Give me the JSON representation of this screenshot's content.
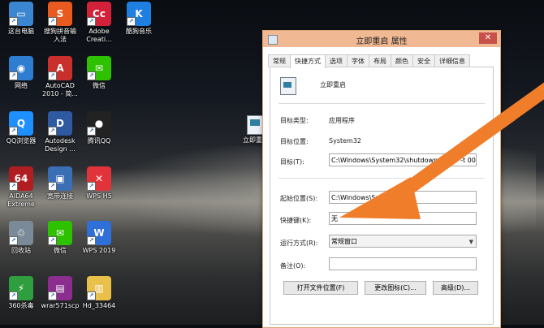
{
  "desktop": {
    "icons": [
      {
        "label": "这台电脑",
        "name": "this-pc-icon",
        "color": "#3a86d1",
        "glyph": "▭"
      },
      {
        "label": "搜狗拼音输\n入法",
        "name": "sogou-input-icon",
        "color": "#e85a1f",
        "glyph": "S"
      },
      {
        "label": "Adobe\nCreati...",
        "name": "adobe-creative-icon",
        "color": "#d4213a",
        "glyph": "Cc"
      },
      {
        "label": "酷狗音乐",
        "name": "kugou-music-icon",
        "color": "#1f7fe0",
        "glyph": "K"
      },
      {
        "label": "网络",
        "name": "network-icon",
        "color": "#2e7dd1",
        "glyph": "◉"
      },
      {
        "label": "AutoCAD\n2010 - 简...",
        "name": "autocad-icon",
        "color": "#c9302c",
        "glyph": "A"
      },
      {
        "label": "微信",
        "name": "wechat-icon",
        "color": "#2dc100",
        "glyph": "✉"
      },
      {
        "label": "QQ浏览器",
        "name": "qq-browser-icon",
        "color": "#1e90ff",
        "glyph": "Q"
      },
      {
        "label": "Autodesk\nDesign ...",
        "name": "autodesk-design-icon",
        "color": "#2d5aa0",
        "glyph": "D"
      },
      {
        "label": "腾讯QQ",
        "name": "tencent-qq-icon",
        "color": "#222222",
        "glyph": "●"
      },
      {
        "label": "AIDA64\nExtreme",
        "name": "aida64-icon",
        "color": "#b11e22",
        "glyph": "64"
      },
      {
        "label": "宽带连接",
        "name": "broadband-icon",
        "color": "#3a6fb5",
        "glyph": "▣"
      },
      {
        "label": "WPS H5",
        "name": "wps-h5-icon",
        "color": "#e0343a",
        "glyph": "✕"
      },
      {
        "label": "回收站",
        "name": "recycle-bin-icon",
        "color": "#7a8a99",
        "glyph": "♲"
      },
      {
        "label": "微信",
        "name": "wechat-icon-2",
        "color": "#2dc100",
        "glyph": "✉"
      },
      {
        "label": "WPS 2019",
        "name": "wps-2019-icon",
        "color": "#2f6fd8",
        "glyph": "W"
      },
      {
        "label": "360杀毒",
        "name": "360-antivirus-icon",
        "color": "#2f9e3e",
        "glyph": "⚡"
      },
      {
        "label": "wrar571scp",
        "name": "winrar-icon",
        "color": "#8b2e8f",
        "glyph": "▤"
      },
      {
        "label": "Hd_33464",
        "name": "folder-icon",
        "color": "#e8c04a",
        "glyph": "▥"
      }
    ],
    "side_icon_label": "立即重启"
  },
  "dialog": {
    "title": "立即重启 属性",
    "close_glyph": "✕",
    "tabs": [
      "常规",
      "快捷方式",
      "选项",
      "字体",
      "布局",
      "颜色",
      "安全",
      "详细信息"
    ],
    "active_tab": 1,
    "app_name": "立即重启",
    "target_type_label": "目标类型:",
    "target_type_value": "应用程序",
    "target_location_label": "目标位置:",
    "target_location_value": "System32",
    "target_label": "目标(T):",
    "target_value": "C:\\Windows\\System32\\shutdown.exe -r -t 00",
    "start_in_label": "起始位置(S):",
    "start_in_value": "C:\\Windows\\System32",
    "hotkey_label": "快捷键(K):",
    "hotkey_value": "无",
    "run_label": "运行方式(R):",
    "run_value": "常规窗口",
    "comment_label": "备注(O):",
    "comment_value": "",
    "btn_open_location": "打开文件位置(F)",
    "btn_change_icon": "更改图标(C)...",
    "btn_advanced": "高级(D)..."
  },
  "annotation": {
    "arrow_color": "#f07d2a"
  },
  "colors": {
    "titlebar": "#f0b893",
    "close": "#c7504a"
  }
}
